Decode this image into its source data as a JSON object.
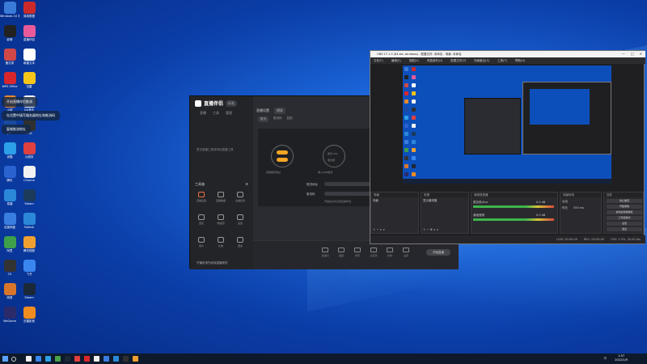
{
  "desktop": {
    "icons": [
      {
        "label": "Windows 10 易升",
        "color": "#3b7bd8"
      },
      {
        "label": "易我数据",
        "color": "#cc2a2a"
      },
      {
        "label": "影像",
        "color": "#222222"
      },
      {
        "label": "直播伴侣",
        "color": "#e85a9a"
      },
      {
        "label": "备忘录",
        "color": "#d04848"
      },
      {
        "label": "新建文本",
        "color": "#ffffff"
      },
      {
        "label": "WPS Office",
        "color": "#d9262c"
      },
      {
        "label": "迅雷",
        "color": "#f5c518"
      },
      {
        "label": "火绒",
        "color": "#e8882a"
      },
      {
        "label": "QQ音乐",
        "color": "#f0f0f0"
      },
      {
        "label": "JSK",
        "color": "#1a4aa0"
      },
      {
        "label": "OBS",
        "color": "#303030"
      },
      {
        "label": "优酷",
        "color": "#2ca0e8"
      },
      {
        "label": "火绒剑",
        "color": "#e04040"
      },
      {
        "label": "腾讯",
        "color": "#2a62d0"
      },
      {
        "label": "Chrome",
        "color": "#f2f2f2"
      },
      {
        "label": "易捷",
        "color": "#2b88d8"
      },
      {
        "label": "Steam",
        "color": "#1b3a5c"
      },
      {
        "label": "百度网盘",
        "color": "#3a7de0"
      },
      {
        "label": "ToDesk",
        "color": "#2b88d8"
      },
      {
        "label": "阿里",
        "color": "#3ea04a"
      },
      {
        "label": "腾讯视频",
        "color": "#f0a030"
      },
      {
        "label": "CS",
        "color": "#333333"
      },
      {
        "label": "飞书",
        "color": "#3a86f0"
      },
      {
        "label": "网易",
        "color": "#d9762a"
      },
      {
        "label": "Steam",
        "color": "#1b2838"
      },
      {
        "label": "WeGame",
        "color": "#2b2b6b"
      },
      {
        "label": "迅雷影音",
        "color": "#f08c20"
      }
    ],
    "tips": [
      "开启直播伴侣推流",
      "在设置中填写服务器地址和推流码",
      "复制推流地址"
    ]
  },
  "streaming_app": {
    "title": "直播伴侣",
    "version": "标准",
    "tabs": [
      "直播",
      "工具",
      "管理"
    ],
    "side_empty": "暂无直播工具请添加直播工具",
    "tools_header": "工具箱",
    "tools": [
      "直播设置",
      "直播数据",
      "主播任务",
      "连麦",
      "粉丝团",
      "设置",
      "观众",
      "礼物",
      "更多"
    ],
    "footer": "开播前请先阅读直播规范",
    "main_header": "直播设置",
    "tag": "横屏",
    "sub_items": [
      "推流",
      "推流码",
      "复制"
    ],
    "obs_text": "OBS第三方推流操作",
    "flow_labels": [
      "复制推流地址",
      "填入OBS推流",
      "开始推流"
    ],
    "flow_mid": "推流 URL",
    "flow_mid2": "服务器",
    "server_label": "推流地址",
    "key_label": "推流码",
    "hint": "开播后请勿关闭直播伴侣",
    "bottom_tools": [
      "直播间",
      "美颜",
      "场景",
      "麦克风",
      "音效",
      "设置"
    ],
    "start_label": "开始直播"
  },
  "obs": {
    "title": "OBS 27.1.3 (64-bit, windows) - 配置文件: 未命名 - 场景: 未命名",
    "menu": [
      "文件(F)",
      "编辑(E)",
      "视图(V)",
      "停靠部件(D)",
      "配置文件(P)",
      "场景集合(S)",
      "工具(T)",
      "帮助(H)"
    ],
    "docks": {
      "scenes": {
        "title": "场景",
        "item": "场景"
      },
      "sources": {
        "title": "来源",
        "item": "显示器采集"
      },
      "mixer": {
        "title": "音频混音器",
        "rows": [
          "麦克风/Aux",
          "桌面音频"
        ],
        "db": [
          "0.0 dB",
          "0.0 dB"
        ]
      },
      "transitions": {
        "title": "场景转场",
        "type": "淡出",
        "duration_label": "时长",
        "duration": "300 ms"
      },
      "controls": {
        "title": "控件",
        "buttons": [
          "停止推流",
          "开始录制",
          "启动虚拟摄像机",
          "工作室模式",
          "设置",
          "退出"
        ]
      }
    },
    "status": [
      "LIVE: 00:00:00",
      "REC: 00:00:00",
      "CPU: 1.5%, 30.00 fps"
    ]
  },
  "taskbar": {
    "time": "1:57",
    "date": "2022/1/9",
    "tray": "中",
    "apps": [
      "#f2f2f2",
      "#3a86f0",
      "#2ca0e8",
      "#4aa24a",
      "#1b2838",
      "#e04040",
      "#d9262c",
      "#f0f0f0",
      "#3a7de0",
      "#2b88d8",
      "#303030",
      "#f0a030"
    ]
  }
}
